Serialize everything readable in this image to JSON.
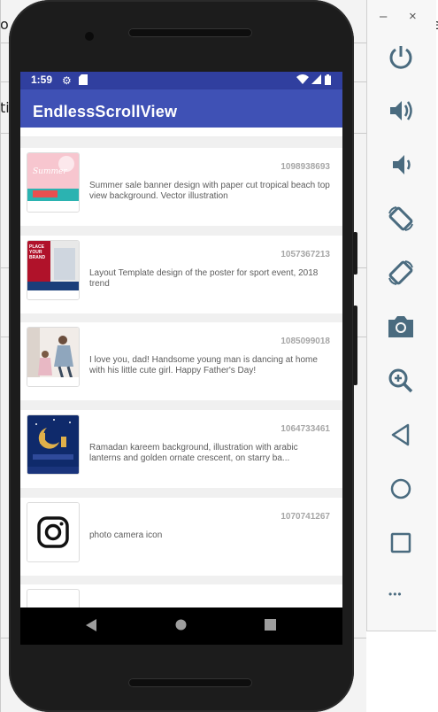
{
  "background_window": {
    "fragment_top_left": "o",
    "fragment_left_mid": "ti",
    "fragment_top_right": "e"
  },
  "status_bar": {
    "time": "1:59"
  },
  "app": {
    "title": "EndlessScrollView"
  },
  "items": [
    {
      "id": "1098938693",
      "description": "Summer sale banner design with paper cut tropical beach top view background. Vector illustration",
      "thumb_text": "Summer"
    },
    {
      "id": "1057367213",
      "description": "Layout Template design of the poster for sport event, 2018 trend",
      "thumb_text": "PLACE YOUR BRAND"
    },
    {
      "id": "1085099018",
      "description": "I love you, dad! Handsome young man is dancing at home with his little cute girl. Happy Father's Day!",
      "thumb_text": ""
    },
    {
      "id": "1064733461",
      "description": "Ramadan kareem background, illustration with arabic lanterns and golden ornate crescent, on starry ba...",
      "thumb_text": ""
    },
    {
      "id": "1070741267",
      "description": "photo camera icon",
      "thumb_text": ""
    }
  ],
  "emulator_panel": {
    "minimize": "–",
    "close": "×",
    "more": "•••"
  },
  "colors": {
    "status_bar": "#303f9f",
    "app_bar": "#3f51b5",
    "panel_icon": "#4a6b7f"
  }
}
